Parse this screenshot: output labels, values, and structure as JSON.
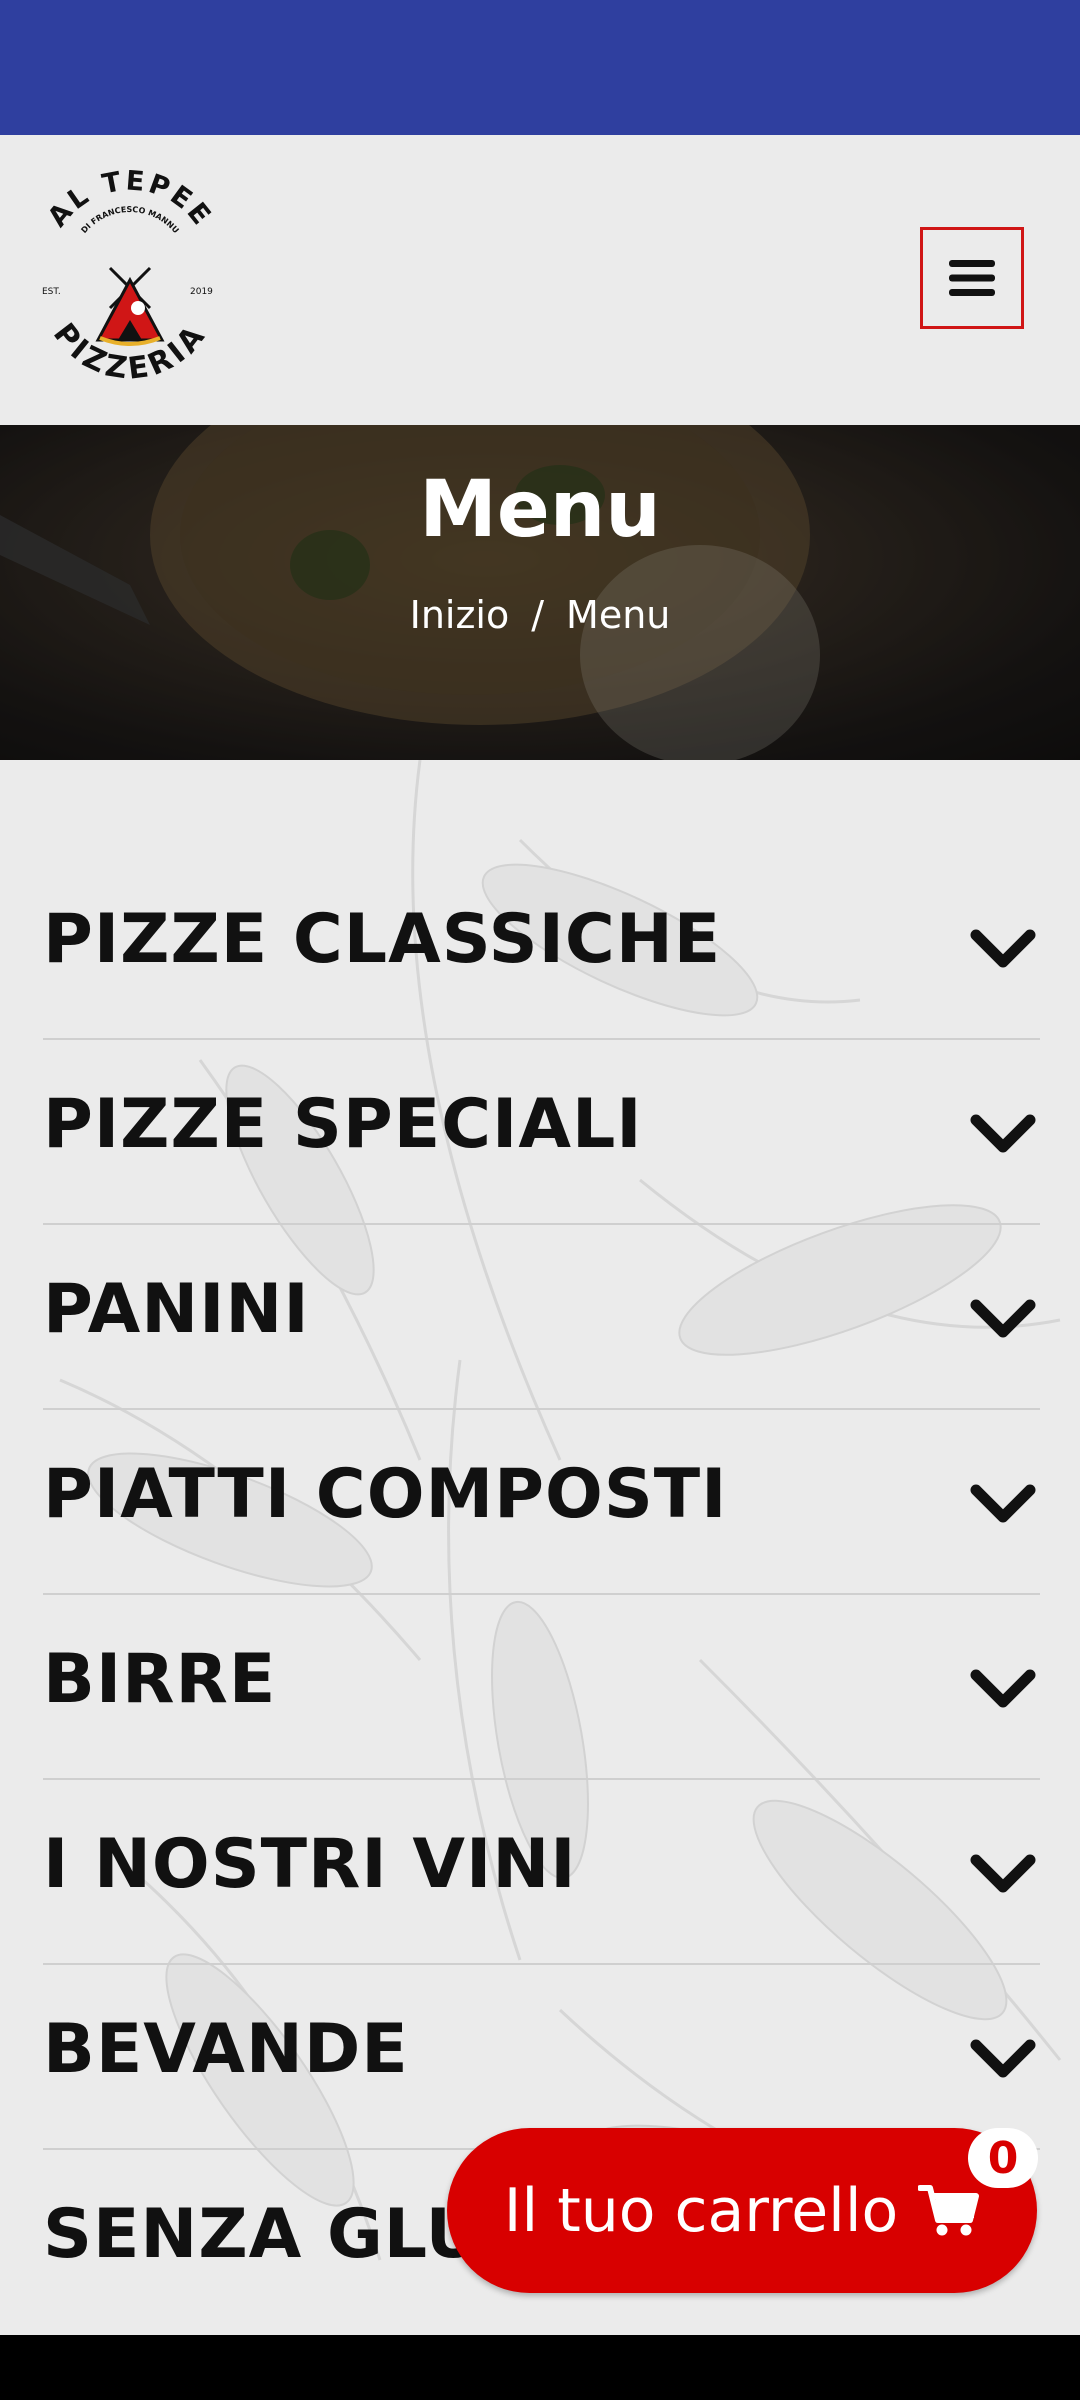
{
  "status_bar": {
    "color": "#2f3f9f"
  },
  "header": {
    "logo": {
      "top_text": "AL TEPEE",
      "subtitle": "DI FRANCESCO MANNU",
      "est_label": "EST.",
      "year": "2019",
      "bottom_text": "PIZZERIA"
    },
    "menu_icon": "hamburger-icon"
  },
  "hero": {
    "title": "Menu",
    "breadcrumb": {
      "home": "Inizio",
      "separator": "/",
      "current": "Menu"
    }
  },
  "menu": {
    "items": [
      {
        "label": "PIZZE CLASSICHE"
      },
      {
        "label": "PIZZE SPECIALI"
      },
      {
        "label": "PANINI"
      },
      {
        "label": "PIATTI COMPOSTI"
      },
      {
        "label": "BIRRE"
      },
      {
        "label": "I NOSTRI VINI"
      },
      {
        "label": "BEVANDE"
      },
      {
        "label": "SENZA GLUT"
      }
    ],
    "expand_icon": "chevron-down-icon"
  },
  "cart": {
    "label": "Il tuo carrello",
    "count": "0",
    "icon": "cart-icon",
    "color": "#d80000"
  }
}
